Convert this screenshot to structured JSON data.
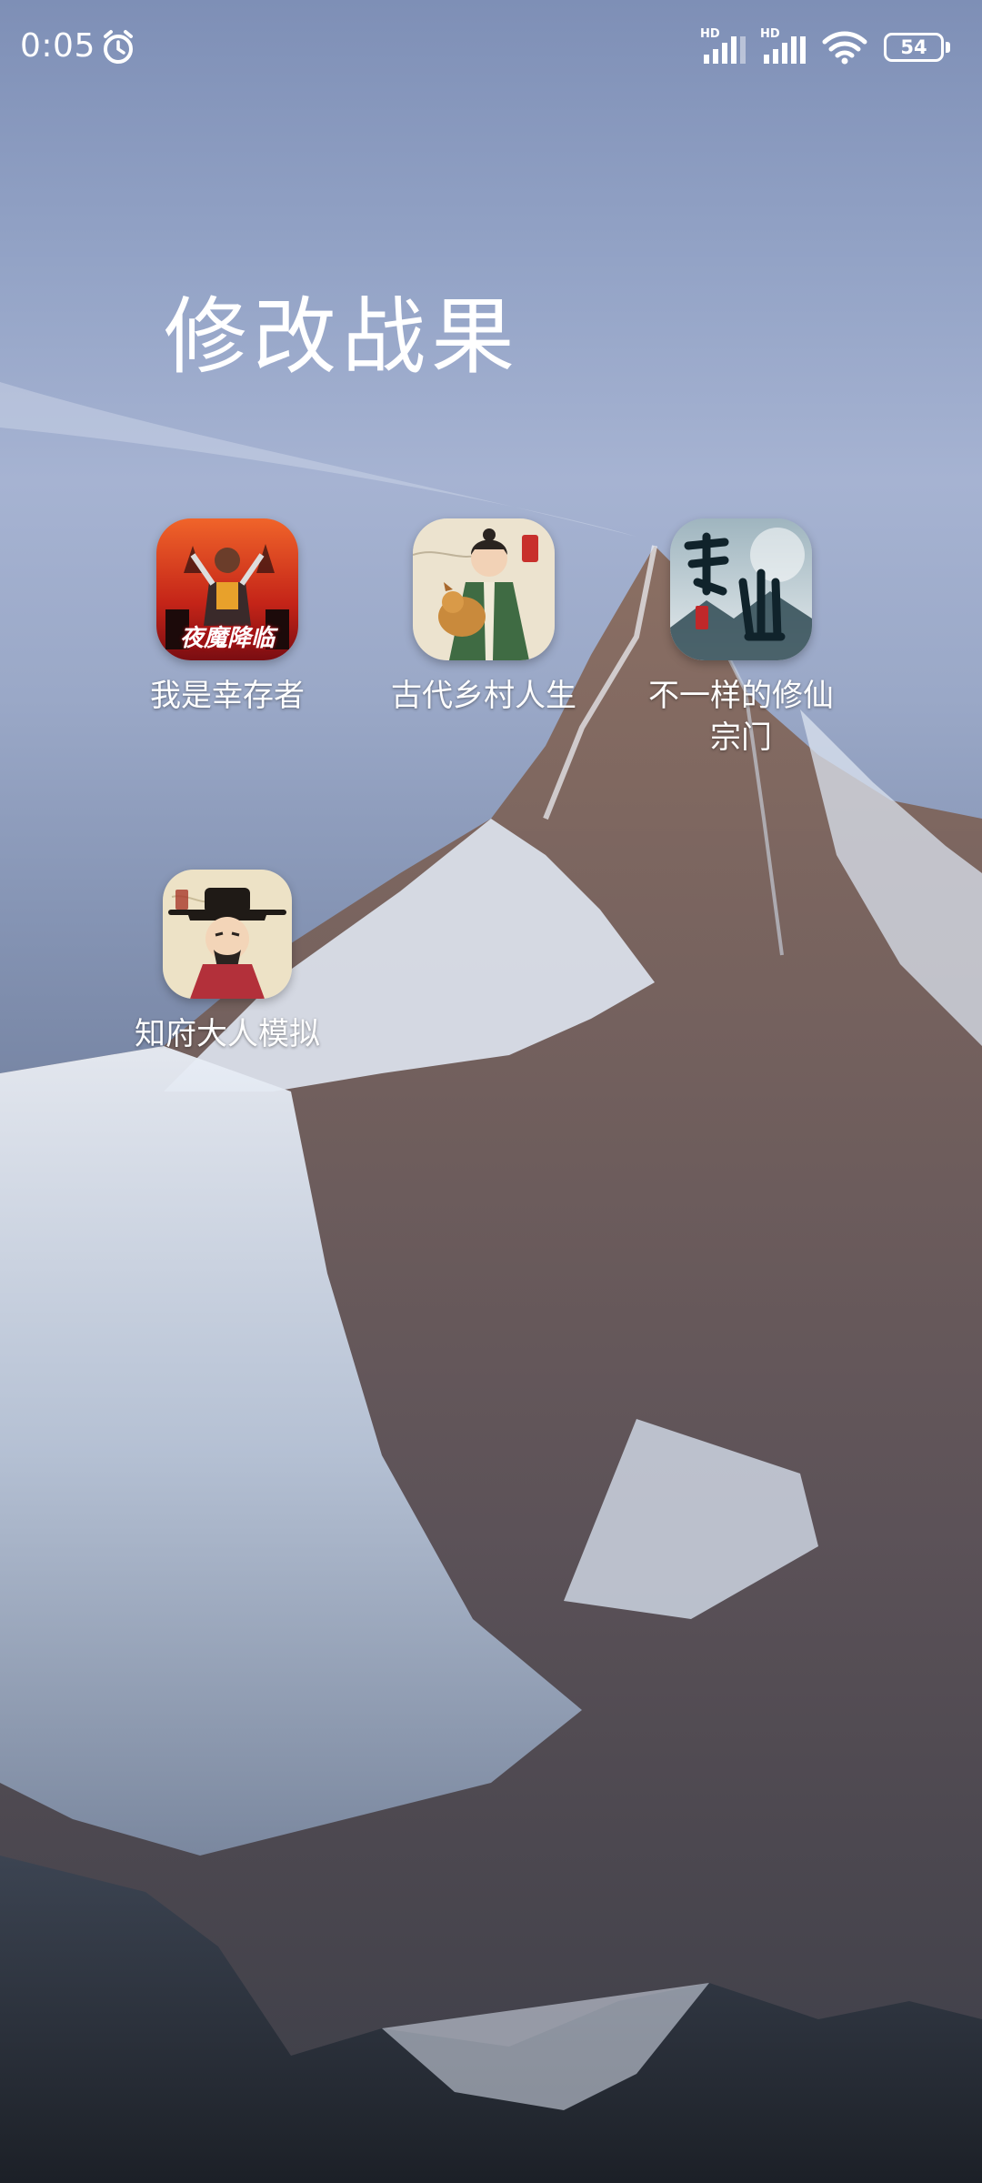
{
  "status_bar": {
    "time": "0:05",
    "signal_1_label": "HD",
    "signal_2_label": "HD",
    "battery_level": "54",
    "icons": [
      "alarm-icon",
      "signal-icon",
      "signal-icon",
      "wifi-icon",
      "battery-icon"
    ]
  },
  "folder": {
    "title": "修改战果",
    "apps": [
      {
        "label": "我是幸存者",
        "icon_text": "夜魔降临",
        "icon": "survivor-game-icon"
      },
      {
        "label": "古代乡村人生",
        "icon": "ancient-village-game-icon"
      },
      {
        "label": "不一样的修仙\n宗门",
        "icon": "xiuxian-game-icon"
      },
      {
        "label": "知府大人模拟",
        "icon": "magistrate-game-icon"
      }
    ]
  },
  "colors": {
    "text": "#ffffff",
    "sky_top": "#7e8fb6",
    "mountain_dark": "#262b35"
  }
}
